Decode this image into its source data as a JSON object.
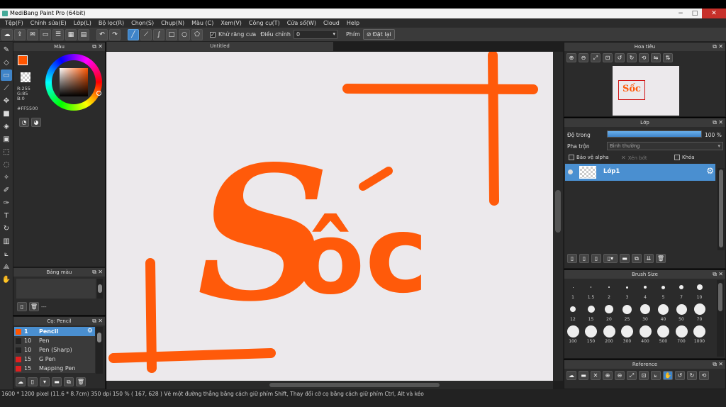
{
  "window": {
    "title": "MediBang Paint Pro (64bit)",
    "controls": [
      "−",
      "□",
      "✕"
    ]
  },
  "menu": [
    "Tệp(F)",
    "Chỉnh sửa(E)",
    "Lớp(L)",
    "Bộ lọc(R)",
    "Chọn(S)",
    "Chụp(N)",
    "Màu (C)",
    "Xem(V)",
    "Công cụ(T)",
    "Cửa sổ(W)",
    "Cloud",
    "Help"
  ],
  "toolbar": {
    "antialias_label": "Khử răng cưa",
    "adjust_label": "Điều chỉnh",
    "adjust_value": "0",
    "key_label": "Phím",
    "reset_label": "Đặt lại"
  },
  "color_panel": {
    "title": "Màu",
    "rgb": "R:255\nG:85\nB:0",
    "hex": "#FF5500",
    "primary_color": "#ff5500"
  },
  "palette_panel": {
    "title": "Bảng màu",
    "dash": "---"
  },
  "brush_panel": {
    "title": "Cọ: Pencil",
    "items": [
      {
        "size": "1",
        "name": "Pencil",
        "color": "#ff5500"
      },
      {
        "size": "10",
        "name": "Pen",
        "color": "#222222"
      },
      {
        "size": "10",
        "name": "Pen (Sharp)",
        "color": "#222222"
      },
      {
        "size": "15",
        "name": "G Pen",
        "color": "#e02020"
      },
      {
        "size": "15",
        "name": "Mapping Pen",
        "color": "#e02020"
      }
    ]
  },
  "document": {
    "tab_title": "Untitled"
  },
  "navigator": {
    "title": "Hoa tiêu",
    "thumb_text": "Sốc"
  },
  "layer_panel": {
    "title": "Lớp",
    "opacity_label": "Độ trong",
    "opacity_value": "100 %",
    "opacity_fraction": 1.0,
    "blend_label": "Pha trộn",
    "blend_value": "Bình thường",
    "protect_alpha": "Bảo vệ alpha",
    "clipping": "Xén bớt",
    "lock": "Khóa",
    "layer_name": "Lớp1"
  },
  "brush_size": {
    "title": "Brush Size",
    "sizes": [
      "1",
      "1.5",
      "2",
      "3",
      "4",
      "5",
      "7",
      "10",
      "12",
      "15",
      "20",
      "25",
      "30",
      "40",
      "50",
      "70",
      "100",
      "150",
      "200",
      "300",
      "400",
      "500",
      "700",
      "1000"
    ]
  },
  "reference": {
    "title": "Reference"
  },
  "status": {
    "dims": "1600 * 1200 pixel",
    "physical": "(11.6 * 8.7cm)",
    "dpi": "350 dpi",
    "zoom": "150 %",
    "coords": "( 167, 628 )",
    "hint": "Vẽ một đường thẳng bằng cách giữ phím Shift, Thay đổi cỡ cọ bằng cách giữ phím Ctrl, Alt và kéo"
  },
  "artwork": {
    "text": "Sốc",
    "stroke_color": "#ff5a0a"
  }
}
